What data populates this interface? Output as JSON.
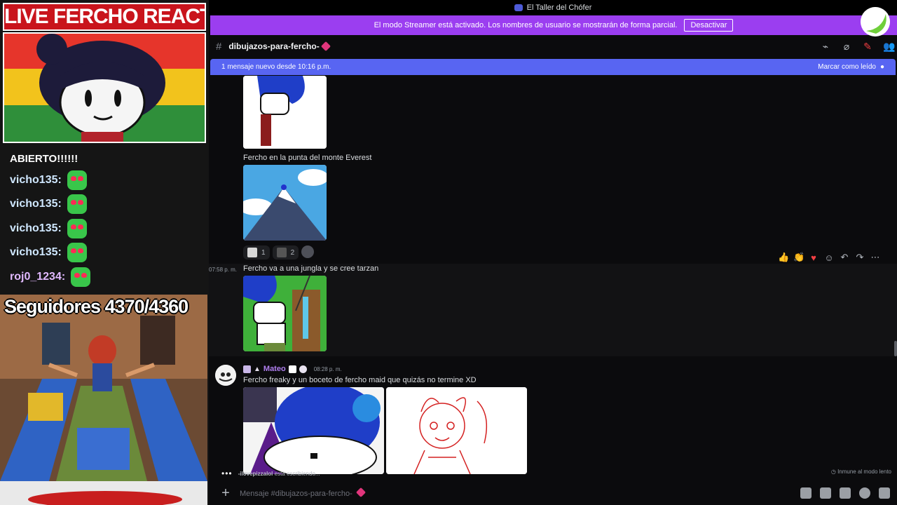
{
  "overlay": {
    "live_title": "LIVE FERCHO REACTION",
    "chat_cut_text": "ABIERTO!!!!!!",
    "chat": [
      {
        "user": "vicho135:",
        "emote": "heart-eyes-emote"
      },
      {
        "user": "vicho135:",
        "emote": "heart-eyes-emote"
      },
      {
        "user": "vicho135:",
        "emote": "heart-eyes-emote"
      },
      {
        "user": "vicho135:",
        "emote": "heart-eyes-emote"
      },
      {
        "user": "roj0_1234:",
        "emote": "heart-eyes-emote"
      }
    ],
    "followers": "Seguidores 4370/4360"
  },
  "window": {
    "title": "El Taller del Chófer"
  },
  "streamer_banner": {
    "text": "El modo Streamer está activado. Los nombres de usuario se mostrarán de forma parcial.",
    "button": "Desactivar"
  },
  "channel": {
    "name": "dibujazos-para-fercho-"
  },
  "new_messages_bar": {
    "text": "1 mensaje nuevo desde 10:16 p.m.",
    "action": "Marcar como leído"
  },
  "messages": {
    "m1_caption": "Fercho en la punta del monte Everest",
    "reactions": [
      {
        "count": "1"
      },
      {
        "count": "2"
      }
    ],
    "m2_time": "07:58 p. m.",
    "m2_text": "Fercho va a una jungla y se cree tarzan",
    "m3_author": "Mateo",
    "m3_time": "08:28 p. m.",
    "m3_text": "Fercho freaky y un boceto de fercho maid que quizás no termine XD"
  },
  "typing": {
    "user": "-ilovepizzalol",
    "suffix": "está escribiendo..."
  },
  "slowmode": "Inmune al modo lento",
  "composer": {
    "placeholder": "Mensaje #dibujazos-para-fercho-"
  },
  "colors": {
    "streamer_banner": "#9b3ef0",
    "new_message_bar": "#5865f2",
    "live_title_bg": "#c9141c",
    "author_name": "#b07ff0"
  }
}
